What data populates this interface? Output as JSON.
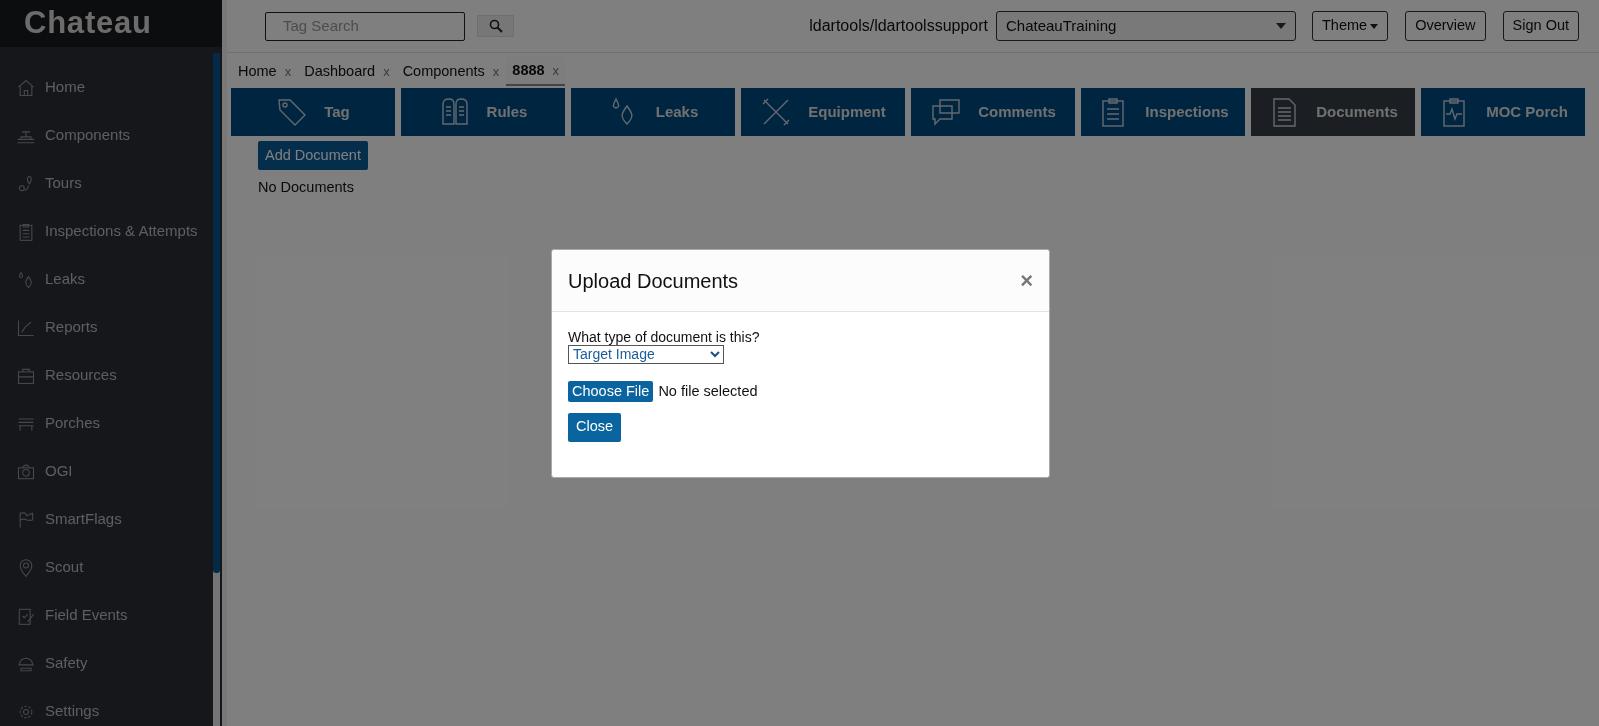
{
  "app": {
    "logo": "Chateau"
  },
  "header": {
    "search": {
      "placeholder": "Tag Search"
    },
    "user": "ldartools/ldartoolssupport",
    "database": {
      "value": "ChateauTraining"
    },
    "buttons": [
      {
        "label": "Theme",
        "kind": "dropdown"
      },
      {
        "label": "Overview",
        "kind": "plain"
      },
      {
        "label": "Sign Out",
        "kind": "plain"
      }
    ]
  },
  "sidebar": {
    "items": [
      {
        "label": "Home"
      },
      {
        "label": "Components"
      },
      {
        "label": "Tours"
      },
      {
        "label": "Inspections & Attempts"
      },
      {
        "label": "Leaks"
      },
      {
        "label": "Reports"
      },
      {
        "label": "Resources"
      },
      {
        "label": "Porches"
      },
      {
        "label": "OGI"
      },
      {
        "label": "SmartFlags"
      },
      {
        "label": "Scout"
      },
      {
        "label": "Field Events"
      },
      {
        "label": "Safety"
      },
      {
        "label": "Settings"
      }
    ]
  },
  "open_tabs": [
    {
      "label": "Home",
      "close": "x",
      "selected": false
    },
    {
      "label": "Dashboard",
      "close": "x",
      "selected": false
    },
    {
      "label": "Components",
      "close": "x",
      "selected": false
    },
    {
      "label": "8888",
      "close": "x",
      "selected": true
    }
  ],
  "sections": [
    {
      "label": "Tag",
      "selected": false
    },
    {
      "label": "Rules",
      "selected": false
    },
    {
      "label": "Leaks",
      "selected": false
    },
    {
      "label": "Equipment",
      "selected": false
    },
    {
      "label": "Comments",
      "selected": false
    },
    {
      "label": "Inspections",
      "selected": false
    },
    {
      "label": "Documents",
      "selected": true
    },
    {
      "label": "MOC Porch",
      "selected": false
    }
  ],
  "documents": {
    "add_button": "Add Document",
    "empty_text": "No Documents"
  },
  "modal": {
    "title": "Upload Documents",
    "close": "×",
    "question": "What type of document is this?",
    "document_type": {
      "value": "Target Image"
    },
    "file_button": "Choose File",
    "file_status": "No file selected",
    "close_button": "Close"
  }
}
